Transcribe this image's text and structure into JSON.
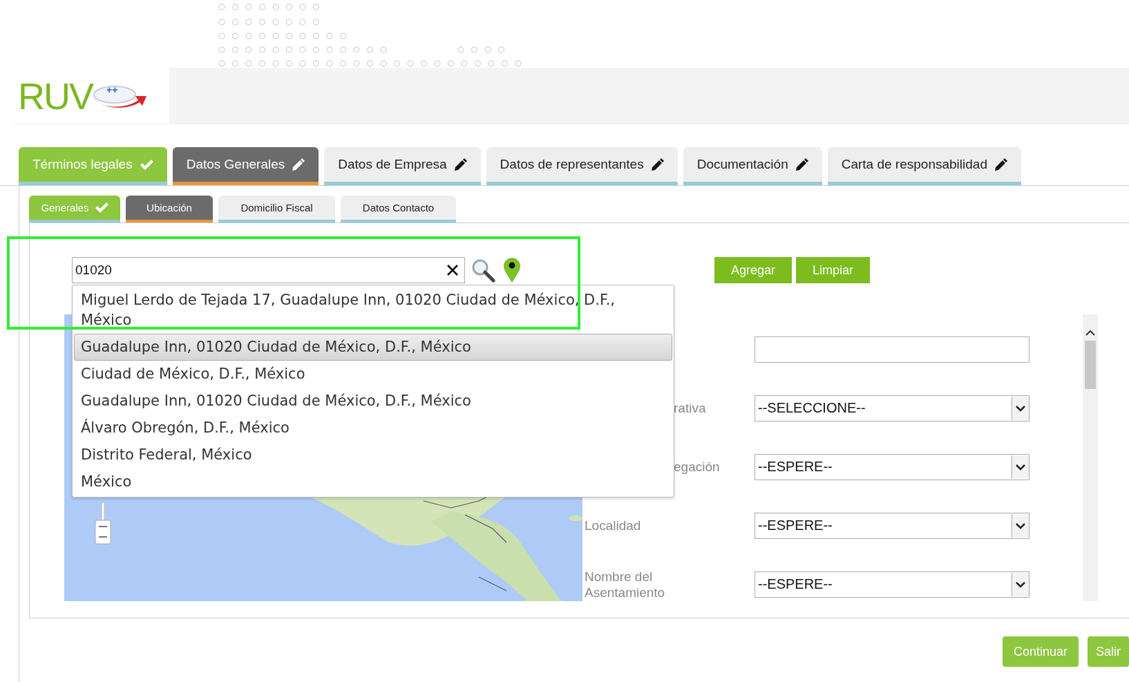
{
  "logo": {
    "text": "RUV",
    "badge": "++"
  },
  "tabs": [
    {
      "label": "Términos legales",
      "selected": false,
      "completed": true
    },
    {
      "label": "Datos Generales",
      "selected": true,
      "completed": false
    },
    {
      "label": "Datos de Empresa",
      "selected": false,
      "completed": false
    },
    {
      "label": "Datos de representantes",
      "selected": false,
      "completed": false
    },
    {
      "label": "Documentación",
      "selected": false,
      "completed": false
    },
    {
      "label": "Carta de responsabilidad",
      "selected": false,
      "completed": false
    }
  ],
  "subtabs": [
    {
      "label": "Generales",
      "selected": false,
      "completed": true
    },
    {
      "label": "Ubicación",
      "selected": true,
      "completed": false
    },
    {
      "label": "Domicilio Fiscal",
      "selected": false,
      "completed": false
    },
    {
      "label": "Datos Contacto",
      "selected": false,
      "completed": false
    }
  ],
  "search": {
    "value": "01020"
  },
  "buttons": [
    "Agregar",
    "Limpiar"
  ],
  "suggestions": [
    {
      "text": "Miguel Lerdo de Tejada 17, Guadalupe Inn, 01020 Ciudad de México, D.F., México",
      "selected": false
    },
    {
      "text": "Guadalupe Inn, 01020 Ciudad de México, D.F., México",
      "selected": true
    },
    {
      "text": "Ciudad de México, D.F., México",
      "selected": false
    },
    {
      "text": "Guadalupe Inn, 01020 Ciudad de México, D.F., México",
      "selected": false
    },
    {
      "text": "Álvaro Obregón, D.F., México",
      "selected": false
    },
    {
      "text": "Distrito Federal, México",
      "selected": false
    },
    {
      "text": "México",
      "selected": false
    }
  ],
  "form": [
    {
      "kind": "text"
    },
    {
      "kind": "select",
      "label": "rativa",
      "value": "--SELECCIONE--"
    },
    {
      "kind": "select",
      "label": "egación",
      "value": "--ESPERE--"
    },
    {
      "kind": "select",
      "label": "Localidad",
      "value": "--ESPERE--"
    },
    {
      "kind": "select",
      "label": "Nombre del Asentamiento",
      "value": "--ESPERE--"
    }
  ],
  "actions": [
    "Continuar",
    "Salir"
  ]
}
